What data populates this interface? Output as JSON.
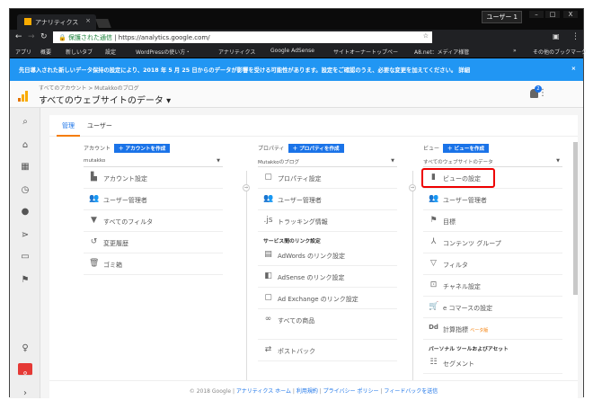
{
  "browser": {
    "tab_title": "アナリティクス",
    "user": "ユーザー 1",
    "secure_label": "保護された通信",
    "url": "https://analytics.google.com/",
    "bookmarks": [
      "アプリ",
      "概要",
      "新しいタブ",
      "設定",
      "WordPressの使い方・",
      "アナリティクス",
      "Google AdSense",
      "サイトオーナートップペー",
      "A8.net：メディア様管",
      "»",
      "その他のブックマーク"
    ]
  },
  "banner": {
    "text": "先日導入された新しいデータ保持の設定により、2018 年 5 月 25 日からのデータが影響を受ける可能性があります。設定をご確認のうえ、必要な変更を加えてください。",
    "link": "詳細"
  },
  "header": {
    "breadcrumb": "すべてのアカウント > Mutakkoのブログ",
    "title": "すべてのウェブサイトのデータ ▾",
    "notifications": "2"
  },
  "tabs": [
    "管理",
    "ユーザー"
  ],
  "account": {
    "label": "アカウント",
    "create": "＋ アカウントを作成",
    "selected": "mutakko",
    "items": [
      "アカウント設定",
      "ユーザー管理者",
      "すべてのフィルタ",
      "変更履歴",
      "ゴミ箱"
    ]
  },
  "property": {
    "label": "プロパティ",
    "create": "＋ プロパティを作成",
    "selected": "Mutakkoのブログ",
    "items": [
      "プロパティ設定",
      "ユーザー管理者",
      "トラッキング情報"
    ],
    "section": "サービス間のリンク設定",
    "links": [
      "AdWords のリンク設定",
      "AdSense のリンク設定",
      "Ad Exchange のリンク設定",
      "すべての商品"
    ],
    "postback": "ポストバック"
  },
  "view": {
    "label": "ビュー",
    "create": "＋ ビューを作成",
    "selected": "すべてのウェブサイトのデータ",
    "items": [
      "ビューの設定",
      "ユーザー管理者",
      "目標",
      "コンテンツ グループ",
      "フィルタ",
      "チャネル設定",
      "e コマースの設定",
      "計算指標"
    ],
    "beta": "ベータ版",
    "section": "パーソナル ツールおよびアセット",
    "segment": "セグメント"
  },
  "footer": {
    "copyright": "© 2018 Google |",
    "links": [
      "アナリティクス ホーム",
      "利用規約",
      "プライバシー ポリシー",
      "フィードバックを送信"
    ]
  }
}
